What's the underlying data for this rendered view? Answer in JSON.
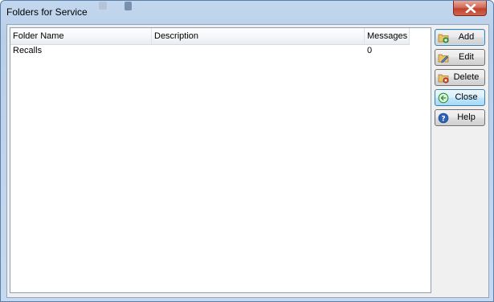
{
  "window": {
    "title": "Folders for Service"
  },
  "list": {
    "columns": [
      "Folder Name",
      "Description",
      "Messages"
    ],
    "rows": [
      {
        "name": "Recalls",
        "description": "",
        "messages": "0"
      }
    ]
  },
  "buttons": {
    "add": {
      "label": "Add",
      "icon": "folder-add-icon"
    },
    "edit": {
      "label": "Edit",
      "icon": "folder-edit-icon"
    },
    "delete": {
      "label": "Delete",
      "icon": "folder-delete-icon"
    },
    "close": {
      "label": "Close",
      "icon": "back-arrow-icon"
    },
    "help": {
      "label": "Help",
      "icon": "help-icon"
    }
  },
  "colors": {
    "title_bar": "#c3d8ef",
    "close_button": "#c0422d",
    "focus_border": "#3c7fb1"
  }
}
